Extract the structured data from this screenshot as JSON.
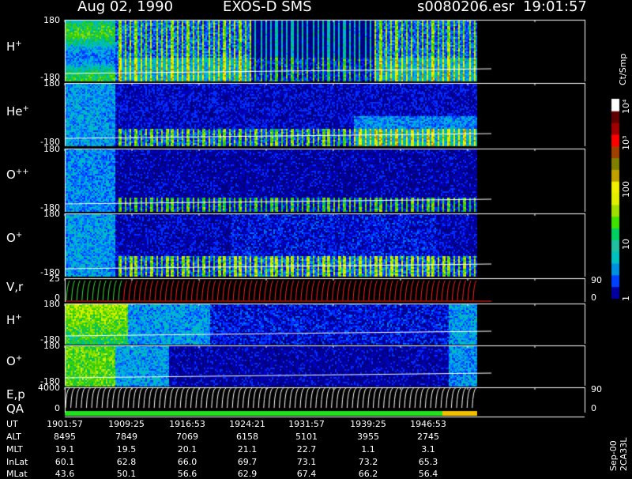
{
  "header": {
    "date": "Aug 02, 1990",
    "instrument": "EXOS-D SMS",
    "file": "s0080206.esr",
    "time": "19:01:57"
  },
  "panels": [
    {
      "label": "H",
      "sup": "+",
      "top_tick": "180",
      "bottom_tick": "-180",
      "kind": "spectrogram"
    },
    {
      "label": "He",
      "sup": "+",
      "top_tick": "180",
      "bottom_tick": "-180",
      "kind": "spectrogram"
    },
    {
      "label": "O",
      "sup": "++",
      "top_tick": "180",
      "bottom_tick": "-180",
      "kind": "spectrogram"
    },
    {
      "label": "O",
      "sup": "+",
      "top_tick": "180",
      "bottom_tick": "-180",
      "kind": "spectrogram"
    },
    {
      "label": "V,r",
      "sup": "",
      "top_tick": "25",
      "bottom_tick": "0",
      "right_top": "90",
      "right_bottom": "0",
      "kind": "line"
    },
    {
      "label": "H",
      "sup": "+",
      "top_tick": "180",
      "bottom_tick": "-180",
      "kind": "spectrogram"
    },
    {
      "label": "O",
      "sup": "+",
      "top_tick": "180",
      "bottom_tick": "-180",
      "kind": "spectrogram"
    },
    {
      "label": "E,p",
      "sup": "",
      "label2": "QA",
      "top_tick": "4000",
      "bottom_tick": "0",
      "right_top": "90",
      "right_bottom": "0",
      "kind": "line"
    }
  ],
  "footer": {
    "labels": [
      "UT",
      "ALT",
      "MLT",
      "InLat",
      "MLat"
    ],
    "columns": [
      [
        "1901:57",
        "8495",
        "19.1",
        "60.1",
        "43.6"
      ],
      [
        "1909:25",
        "7849",
        "19.5",
        "62.8",
        "50.1"
      ],
      [
        "1916:53",
        "7069",
        "20.1",
        "66.0",
        "56.6"
      ],
      [
        "1924:21",
        "6158",
        "21.1",
        "69.7",
        "62.9"
      ],
      [
        "1931:57",
        "5101",
        "22.7",
        "73.1",
        "67.4"
      ],
      [
        "1939:25",
        "3955",
        "1.1",
        "73.2",
        "66.2"
      ],
      [
        "1946:53",
        "2745",
        "3.1",
        "65.3",
        "56.4"
      ]
    ]
  },
  "colorbar": {
    "title": "Ct/Smp",
    "ticks": [
      "1",
      "10",
      "100",
      "10³",
      "10⁴"
    ],
    "colors": [
      "#0000a0",
      "#0040ff",
      "#0090e0",
      "#00c0c0",
      "#20c0a0",
      "#00d060",
      "#40e000",
      "#a0e000",
      "#e0f000",
      "#f0f000",
      "#c0a000",
      "#808000",
      "#a04000",
      "#ff0000",
      "#a00000",
      "#600000",
      "#ffffff"
    ]
  },
  "side_note": "Sep-00 2CA33L",
  "colors": {
    "low": "#000080",
    "mid": "#00c000",
    "high": "#f0f000",
    "trace": "#ffffff",
    "trace_red": "#ff2020"
  },
  "chart_data": {
    "type": "heatmap",
    "title": "Aug 02, 1990   EXOS-D SMS",
    "x_ticks": [
      "1901:57",
      "1909:25",
      "1916:53",
      "1924:21",
      "1931:57",
      "1939:25",
      "1946:53"
    ],
    "colorbar_units": "Ct/Smp",
    "colorbar_scale": "log",
    "colorbar_range": [
      1,
      10000
    ],
    "series": [
      {
        "name": "H+",
        "ylim": [
          -180,
          180
        ]
      },
      {
        "name": "He+",
        "ylim": [
          -180,
          180
        ]
      },
      {
        "name": "O++",
        "ylim": [
          -180,
          180
        ]
      },
      {
        "name": "O+",
        "ylim": [
          -180,
          180
        ]
      },
      {
        "name": "V,r",
        "ylim": [
          0,
          25
        ],
        "right_ylim": [
          0,
          90
        ]
      },
      {
        "name": "H+",
        "ylim": [
          -180,
          180
        ]
      },
      {
        "name": "O+",
        "ylim": [
          -180,
          180
        ]
      },
      {
        "name": "E,p",
        "ylim": [
          0,
          4000
        ],
        "right_ylim": [
          0,
          90
        ]
      }
    ],
    "x_range": [
      "1901:57",
      "1950:00"
    ],
    "grid": false
  }
}
